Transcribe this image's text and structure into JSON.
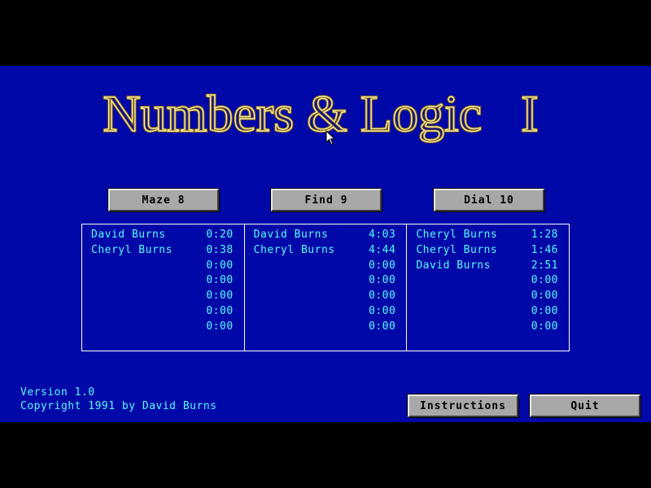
{
  "title": "Numbers & Logic   I",
  "colors": {
    "background": "#0008a8",
    "title": "#f8f0a0",
    "title_outline": "#7a5818",
    "text": "#54fcfc",
    "button_face": "#a8a8a8",
    "table_border": "#ffffff"
  },
  "games": [
    {
      "button_label": "Maze 8",
      "scores": [
        {
          "name": "David Burns",
          "time": "0:20"
        },
        {
          "name": "Cheryl Burns",
          "time": "0:38"
        },
        {
          "name": "",
          "time": "0:00"
        },
        {
          "name": "",
          "time": "0:00"
        },
        {
          "name": "",
          "time": "0:00"
        },
        {
          "name": "",
          "time": "0:00"
        },
        {
          "name": "",
          "time": "0:00"
        }
      ]
    },
    {
      "button_label": "Find 9",
      "scores": [
        {
          "name": "David Burns",
          "time": "4:03"
        },
        {
          "name": "Cheryl Burns",
          "time": "4:44"
        },
        {
          "name": "",
          "time": "0:00"
        },
        {
          "name": "",
          "time": "0:00"
        },
        {
          "name": "",
          "time": "0:00"
        },
        {
          "name": "",
          "time": "0:00"
        },
        {
          "name": "",
          "time": "0:00"
        }
      ]
    },
    {
      "button_label": "Dial 10",
      "scores": [
        {
          "name": "Cheryl Burns",
          "time": "1:28"
        },
        {
          "name": "Cheryl Burns",
          "time": "1:46"
        },
        {
          "name": "David Burns",
          "time": "2:51"
        },
        {
          "name": "",
          "time": "0:00"
        },
        {
          "name": "",
          "time": "0:00"
        },
        {
          "name": "",
          "time": "0:00"
        },
        {
          "name": "",
          "time": "0:00"
        }
      ]
    }
  ],
  "footer": {
    "version": "Version 1.0",
    "copyright": "Copyright 1991 by David Burns",
    "instructions_label": "Instructions",
    "quit_label": "Quit"
  },
  "icons": {
    "cursor": "mouse-pointer-icon"
  }
}
